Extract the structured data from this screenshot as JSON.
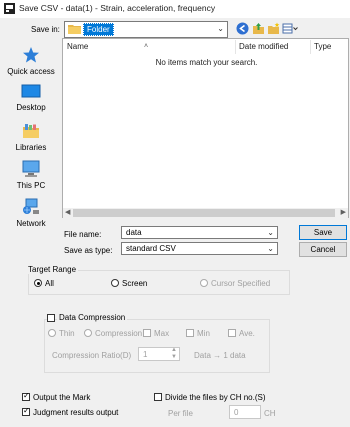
{
  "window": {
    "title": "Save CSV - data(1) - Strain, acceleration, frequency"
  },
  "toolbar": {
    "save_in_label": "Save in:",
    "save_in_value": "Folder"
  },
  "places": [
    {
      "label": "Quick access",
      "icon": "star-icon"
    },
    {
      "label": "Desktop",
      "icon": "desktop-icon"
    },
    {
      "label": "Libraries",
      "icon": "library-icon"
    },
    {
      "label": "This PC",
      "icon": "computer-icon"
    },
    {
      "label": "Network",
      "icon": "network-icon"
    }
  ],
  "file_list": {
    "columns": [
      "Name",
      "Date modified",
      "Type"
    ],
    "empty_message": "No items match your search."
  },
  "file_name": {
    "label": "File name:",
    "value": "data"
  },
  "save_as_type": {
    "label": "Save as type:",
    "value": "standard CSV"
  },
  "buttons": {
    "save": "Save",
    "cancel": "Cancel"
  },
  "target_range": {
    "title": "Target Range",
    "options": [
      "All",
      "Screen",
      "Cursor Specified"
    ],
    "selected": "All"
  },
  "data_compression": {
    "title": "Data Compression",
    "options": [
      "Thin",
      "Compression"
    ],
    "checks": [
      "Max",
      "Min",
      "Ave."
    ],
    "ratio_label": "Compression Ratio(D)",
    "ratio_value": "1",
    "ratio_note": "Data → 1 data"
  },
  "output_mark": {
    "label": "Output the Mark",
    "checked": true
  },
  "judgment_output": {
    "label": "Judgment results output",
    "checked": true
  },
  "divide_files": {
    "label": "Divide the files by CH no.(S)",
    "checked": false
  },
  "per_file": {
    "label": "Per file",
    "value": "0",
    "unit": "CH"
  },
  "colors": {
    "accent": "#0078d7",
    "folder": "#e8b84a"
  }
}
